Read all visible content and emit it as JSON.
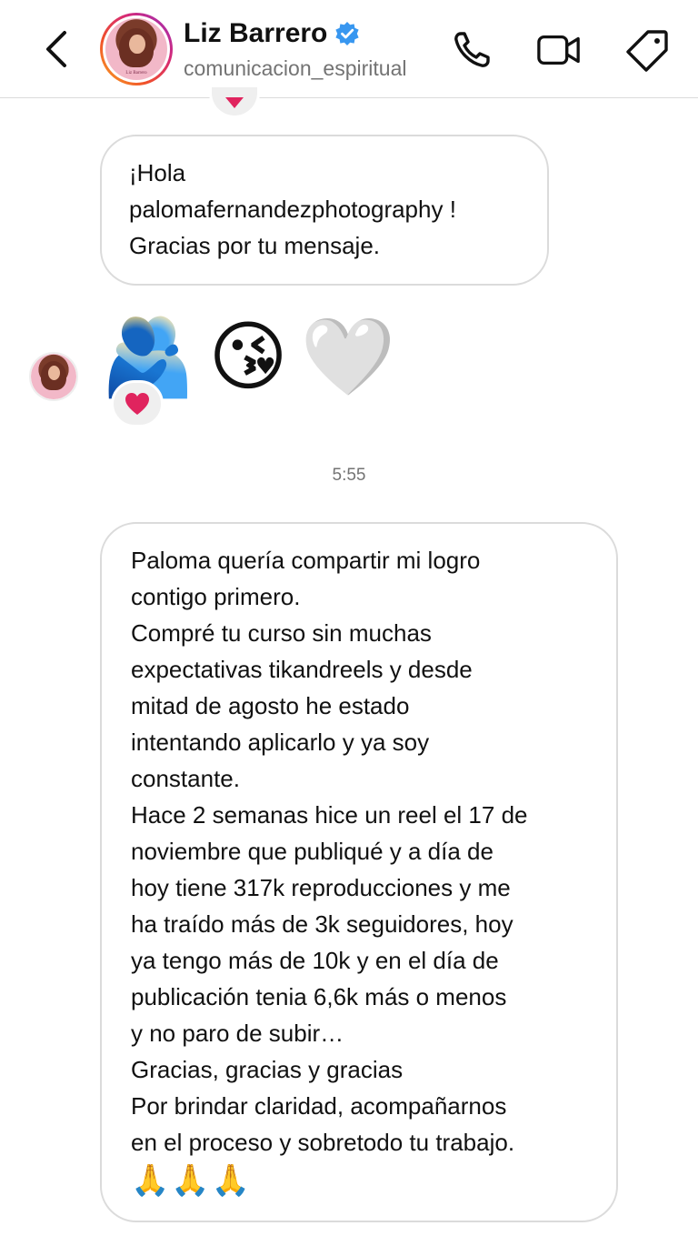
{
  "header": {
    "back_icon": "chevron-left-icon",
    "name": "Liz Barrero",
    "verified_icon": "verified-badge-icon",
    "username": "comunicacion_espiritual",
    "avatar_caption": "Liz Barrero",
    "actions": [
      "phone-icon",
      "video-camera-icon",
      "tag-icon"
    ]
  },
  "messages": {
    "first": {
      "lines": [
        "¡Hola",
        "palomafernandezphotography !",
        "Gracias por tu mensaje."
      ]
    },
    "emojis": [
      "🫂",
      "😘",
      "🤍"
    ],
    "reaction": "❤️",
    "timestamp": "5:55",
    "second": {
      "lines": [
        "Paloma quería compartir mi logro",
        "contigo primero.",
        "Compré tu curso sin muchas",
        "expectativas tikandreels y desde",
        "mitad de agosto he estado",
        "intentando aplicarlo y ya soy",
        "constante.",
        "Hace 2 semanas hice un reel el 17 de",
        "noviembre que publiqué y a día de",
        "hoy tiene 317k reproducciones y me",
        "ha traído más de 3k seguidores, hoy",
        "ya tengo más de 10k y en el día de",
        "publicación tenia 6,6k más o menos",
        "y no paro de subir…",
        "Gracias, gracias y gracias",
        "Por brindar claridad, acompañarnos",
        "en el proceso y sobretodo tu trabajo.",
        "🙏🙏🙏"
      ]
    }
  },
  "colors": {
    "accent_verified": "#3897f0",
    "bubble_border": "#dbdbdb",
    "muted_text": "#737373",
    "reaction_bg": "#efefef",
    "heart": "#e0245e"
  }
}
